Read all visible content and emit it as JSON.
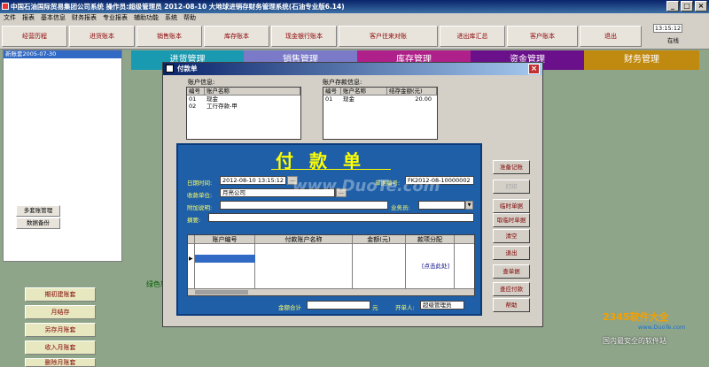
{
  "app": {
    "title": "中国石油国际贸易集团公司系统    操作员:超级管理员    2012-08-10  大地球进销存财务管理系统(石油专业版6.14)"
  },
  "menu": [
    "文件",
    "报表",
    "基本信息",
    "财务报表",
    "专业报表",
    "辅助功能",
    "系统",
    "帮助"
  ],
  "toolbar": {
    "buttons": [
      "经营历程",
      "进货账本",
      "销售账本",
      "库存账本",
      "现金银行账本",
      "客户往来对账",
      "进出库汇总",
      "客户账本",
      "退出"
    ],
    "clock": "13:15:12",
    "status": "在线"
  },
  "left_panel": {
    "items": [
      "新账套2005-07-30"
    ],
    "btn_multi": "多套账管理",
    "btn_backup": "数据备份"
  },
  "side_buttons": [
    "期初建账套",
    "月结存",
    "另存月账套",
    "收入月账套",
    "删除月账套"
  ],
  "bg_tabs": [
    "进货管理",
    "销售管理",
    "库存管理",
    "资金管理",
    "财务管理"
  ],
  "green_label": "绿色软",
  "dialog": {
    "title": "付款单",
    "acct_info": {
      "label": "账户信息:",
      "headers": [
        "编号",
        "账户名称"
      ],
      "rows": [
        [
          "01",
          "现金"
        ],
        [
          "02",
          "工行存款-甲"
        ]
      ]
    },
    "acct_balance": {
      "label": "账户存款信息:",
      "headers": [
        "编号",
        "账户名称",
        "结存金额(元)"
      ],
      "rows": [
        [
          "01",
          "现金",
          "20.00"
        ]
      ]
    },
    "form": {
      "title": "付款单",
      "date_label": "日期时间:",
      "date_value": "2012-08-10 13:15:12",
      "doc_label": "单据编号:",
      "doc_value": "FK2012-08-10000002",
      "payee_label": "收款单位:",
      "payee_value": "月亮公司",
      "note_label": "附加说明:",
      "note_value": "",
      "clerk_label": "业务员:",
      "clerk_value": "",
      "summary_label": "摘要:",
      "summary_value": "",
      "grid_headers": [
        "账户编号",
        "付款账户名称",
        "金额(元)",
        "款项分配"
      ],
      "grid_click": "[点击此处]",
      "total_label": "金额合计",
      "total_unit": "元",
      "opener_label": "开单人:",
      "opener_value": "超级管理员"
    },
    "buttons": [
      "准备记账",
      "打印",
      "临时单据",
      "取临时单据",
      "清空",
      "退出",
      "查单据",
      "查应付款",
      "帮助"
    ]
  },
  "watermarks": {
    "center": "www.DuoTe.com",
    "brand": "2345软件大全",
    "url": "www.DuoTe.com",
    "slogan": "国内最安全的软件站"
  }
}
